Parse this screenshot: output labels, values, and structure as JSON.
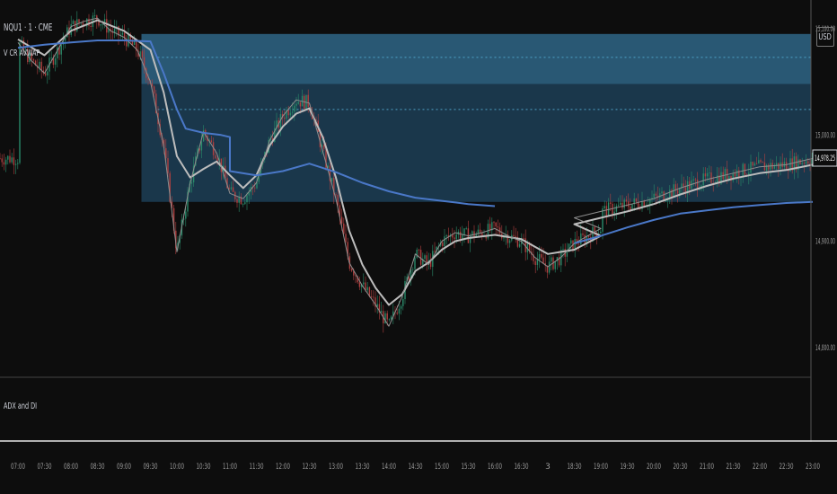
{
  "symbol_title": "NQU1 · 1 · CME",
  "indicator_label": "V CR AVWAP",
  "sub_indicator_label": "ADX and DI",
  "currency": "USD",
  "chart_data": {
    "type": "candlestick",
    "x_ticks": [
      "07:00",
      "07:30",
      "08:00",
      "08:30",
      "09:00",
      "09:30",
      "10:00",
      "10:30",
      "11:00",
      "11:30",
      "12:00",
      "12:30",
      "13:00",
      "13:30",
      "14:00",
      "14:30",
      "15:00",
      "15:30",
      "16:00",
      "16:30",
      "3",
      "18:30",
      "19:00",
      "19:30",
      "20:00",
      "20:30",
      "21:00",
      "21:30",
      "22:00",
      "22:30",
      "23:00"
    ],
    "y_ticks": [
      15100.0,
      15000.0,
      14900.0,
      14800.0
    ],
    "last_price": 14978.25,
    "ylim": [
      14772,
      15127
    ],
    "zones": [
      {
        "from_time": "09:30",
        "to_time": "23:00",
        "low": 14937,
        "high": 15095,
        "color": "#1b3a4f"
      },
      {
        "from_time": "09:30",
        "to_time": "23:00",
        "low": 15048,
        "high": 15095,
        "color": "#2a5a76"
      }
    ],
    "dotted_levels": [
      15073,
      15024
    ],
    "avwap_color": "#4a78c8",
    "candle_up": "#2a8a6a",
    "candle_down": "#b04040",
    "avwap": [
      [
        "07:00",
        15082
      ],
      [
        "07:30",
        15085
      ],
      [
        "08:00",
        15087
      ],
      [
        "08:30",
        15089
      ],
      [
        "09:00",
        15089
      ],
      [
        "09:30",
        15088
      ],
      [
        "09:45",
        15058
      ],
      [
        "10:00",
        15024
      ],
      [
        "10:10",
        15006
      ],
      [
        "10:30",
        15002
      ],
      [
        "10:50",
        15000
      ],
      [
        "11:00",
        14998
      ],
      [
        "11:00",
        14966
      ],
      [
        "11:30",
        14962
      ],
      [
        "12:00",
        14966
      ],
      [
        "12:30",
        14973
      ],
      [
        "13:00",
        14965
      ],
      [
        "13:30",
        14955
      ],
      [
        "14:00",
        14947
      ],
      [
        "14:30",
        14941
      ],
      [
        "15:00",
        14938
      ],
      [
        "15:30",
        14935
      ],
      [
        "16:00",
        14933
      ],
      [
        "18:30",
        14898
      ],
      [
        "19:00",
        14905
      ],
      [
        "19:30",
        14913
      ],
      [
        "20:00",
        14920
      ],
      [
        "20:30",
        14926
      ],
      [
        "21:00",
        14929
      ],
      [
        "21:30",
        14932
      ],
      [
        "22:00",
        14934
      ],
      [
        "22:30",
        14936
      ],
      [
        "23:00",
        14937
      ]
    ],
    "ma_fast": [
      [
        "07:00",
        15087
      ],
      [
        "07:15",
        15070
      ],
      [
        "07:30",
        15058
      ],
      [
        "07:45",
        15080
      ],
      [
        "08:00",
        15102
      ],
      [
        "08:15",
        15107
      ],
      [
        "08:30",
        15110
      ],
      [
        "08:45",
        15098
      ],
      [
        "09:00",
        15092
      ],
      [
        "09:15",
        15080
      ],
      [
        "09:30",
        15050
      ],
      [
        "09:45",
        14990
      ],
      [
        "10:00",
        14890
      ],
      [
        "10:15",
        14955
      ],
      [
        "10:30",
        15003
      ],
      [
        "10:45",
        14983
      ],
      [
        "11:00",
        14945
      ],
      [
        "11:15",
        14940
      ],
      [
        "11:30",
        14955
      ],
      [
        "11:45",
        14995
      ],
      [
        "12:00",
        15018
      ],
      [
        "12:15",
        15033
      ],
      [
        "12:30",
        15030
      ],
      [
        "12:45",
        14985
      ],
      [
        "13:00",
        14940
      ],
      [
        "13:15",
        14880
      ],
      [
        "13:30",
        14858
      ],
      [
        "13:45",
        14840
      ],
      [
        "14:00",
        14820
      ],
      [
        "14:15",
        14848
      ],
      [
        "14:30",
        14888
      ],
      [
        "14:45",
        14878
      ],
      [
        "15:00",
        14900
      ],
      [
        "15:15",
        14908
      ],
      [
        "15:30",
        14905
      ],
      [
        "15:45",
        14908
      ],
      [
        "16:00",
        14912
      ],
      [
        "16:15",
        14905
      ],
      [
        "16:30",
        14900
      ],
      [
        "16:45",
        14885
      ],
      [
        "17:00",
        14876
      ],
      [
        "17:15",
        14885
      ],
      [
        "17:30",
        14898
      ],
      [
        "18:00",
        14912
      ],
      [
        "18:30",
        14922
      ],
      [
        "19:00",
        14928
      ],
      [
        "19:30",
        14934
      ],
      [
        "20:00",
        14940
      ],
      [
        "20:30",
        14950
      ],
      [
        "21:00",
        14958
      ],
      [
        "21:30",
        14964
      ],
      [
        "22:00",
        14970
      ],
      [
        "22:30",
        14972
      ],
      [
        "23:00",
        14978
      ]
    ],
    "ma_mid": [
      [
        "07:00",
        15090
      ],
      [
        "07:30",
        15075
      ],
      [
        "08:00",
        15098
      ],
      [
        "08:30",
        15108
      ],
      [
        "09:00",
        15098
      ],
      [
        "09:30",
        15080
      ],
      [
        "09:45",
        15040
      ],
      [
        "10:00",
        14980
      ],
      [
        "10:15",
        14960
      ],
      [
        "10:30",
        14968
      ],
      [
        "10:45",
        14975
      ],
      [
        "11:00",
        14962
      ],
      [
        "11:15",
        14950
      ],
      [
        "11:30",
        14962
      ],
      [
        "11:45",
        14990
      ],
      [
        "12:00",
        15008
      ],
      [
        "12:15",
        15020
      ],
      [
        "12:30",
        15025
      ],
      [
        "12:45",
        14998
      ],
      [
        "13:00",
        14960
      ],
      [
        "13:15",
        14910
      ],
      [
        "13:30",
        14878
      ],
      [
        "13:45",
        14856
      ],
      [
        "14:00",
        14840
      ],
      [
        "14:15",
        14850
      ],
      [
        "14:30",
        14872
      ],
      [
        "14:45",
        14880
      ],
      [
        "15:00",
        14892
      ],
      [
        "15:15",
        14900
      ],
      [
        "15:30",
        14903
      ],
      [
        "16:00",
        14906
      ],
      [
        "16:30",
        14902
      ],
      [
        "17:00",
        14888
      ],
      [
        "17:30",
        14892
      ],
      [
        "18:00",
        14905
      ],
      [
        "18:30",
        14916
      ],
      [
        "19:00",
        14922
      ],
      [
        "19:30",
        14928
      ],
      [
        "20:00",
        14935
      ],
      [
        "20:30",
        14944
      ],
      [
        "21:00",
        14952
      ],
      [
        "21:30",
        14959
      ],
      [
        "22:00",
        14964
      ],
      [
        "22:30",
        14967
      ],
      [
        "23:00",
        14972
      ]
    ]
  }
}
